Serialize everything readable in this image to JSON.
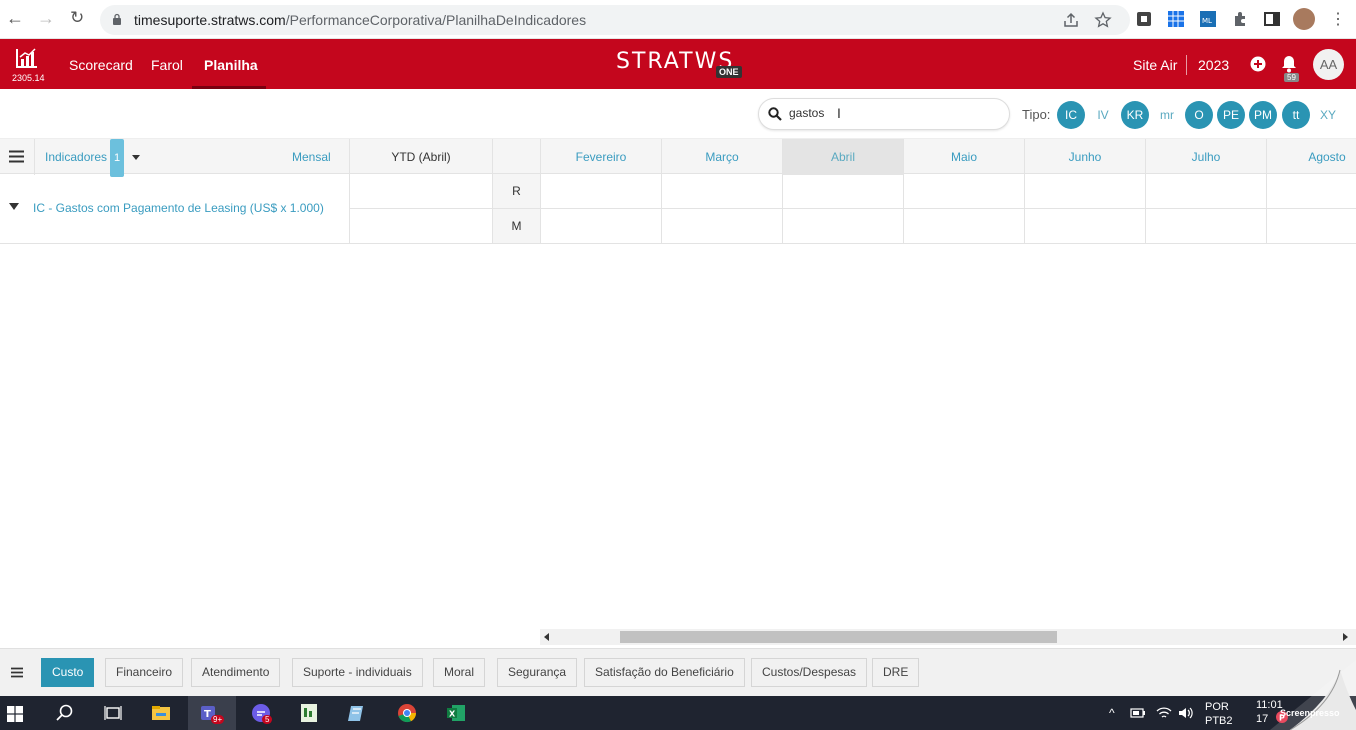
{
  "browser": {
    "url_host": "timesuporte.stratws.com",
    "url_path": "/PerformanceCorporativa/PlanilhaDeIndicadores"
  },
  "app": {
    "version": "2305.14",
    "nav": [
      "Scorecard",
      "Farol",
      "Planilha"
    ],
    "logo_text": "STRATWS",
    "logo_badge": "ONE",
    "site": "Site Air",
    "year": "2023",
    "notification_count": "59",
    "avatar_initials": "AA"
  },
  "filters": {
    "search_value": "gastos",
    "tipo_label": "Tipo:",
    "tipos": [
      {
        "label": "IC",
        "on": true
      },
      {
        "label": "IV",
        "on": false
      },
      {
        "label": "KR",
        "on": true
      },
      {
        "label": "mr",
        "on": false
      },
      {
        "label": "O",
        "on": true
      },
      {
        "label": "PE",
        "on": true
      },
      {
        "label": "PM",
        "on": true
      },
      {
        "label": "tt",
        "on": true
      },
      {
        "label": "XY",
        "on": false
      }
    ]
  },
  "grid": {
    "indicators_label": "Indicadores",
    "indicators_count": "1",
    "period_label": "Mensal",
    "ytd_label": "YTD (Abril)",
    "months": [
      "Fevereiro",
      "Março",
      "Abril",
      "Maio",
      "Junho",
      "Julho",
      "Agosto"
    ],
    "rows": [
      {
        "name": "IC - Gastos com Pagamento de Leasing (US$ x 1.000)",
        "series": [
          "R",
          "M"
        ]
      }
    ]
  },
  "tabs": [
    "Custo",
    "Financeiro",
    "Atendimento",
    "Suporte - individuais",
    "Moral",
    "Segurança",
    "Satisfação do Beneficiário",
    "Custos/Despesas",
    "DRE"
  ],
  "taskbar": {
    "lang_top": "POR",
    "lang_bottom": "PTB2",
    "time": "11:01",
    "date_partial": "17",
    "teams_badge": "9+",
    "app_badge": "5",
    "screenpresso": "Screenpresso"
  },
  "colors": {
    "brand_red": "#c4061d",
    "accent_blue": "#2a94b3",
    "link_blue": "#3a9cc0"
  }
}
